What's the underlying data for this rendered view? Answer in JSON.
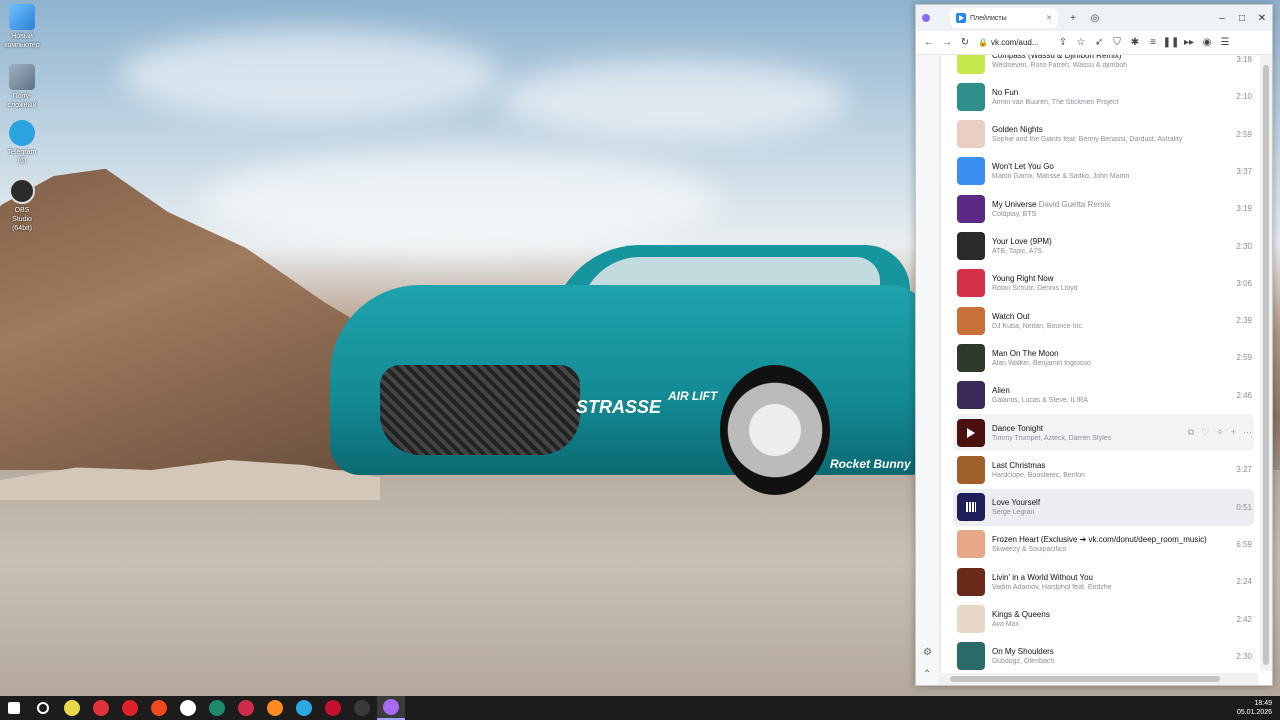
{
  "desktop": {
    "icons": [
      {
        "label": "Новый компьютер"
      },
      {
        "label": "Полу-сложный"
      },
      {
        "label": "Telegram (6)"
      },
      {
        "label": "OBS Studio (64bit)"
      }
    ]
  },
  "browser": {
    "tab_title": "Плейлисты",
    "url": "vk.com/aud...",
    "new_tab": "+",
    "window_controls": {
      "minimize": "–",
      "maximize": "□",
      "close": "✕"
    }
  },
  "tracks": [
    {
      "title": "Compass (Wassu & Djimboh Remix)",
      "subtitle": "",
      "artist": "Westseven, Ross Farren, Wassu & djimboh",
      "duration": "3:18",
      "color": "#c7e84a"
    },
    {
      "title": "No Fun",
      "subtitle": "",
      "artist": "Armin van Buuren, The Stickmen Project",
      "duration": "2:10",
      "color": "#2f8f8a"
    },
    {
      "title": "Golden Nights",
      "subtitle": "",
      "artist": "Sophie and the Giants feat. Benny Benassi, Dardust, Astrality",
      "duration": "2:59",
      "color": "#e8cfc2"
    },
    {
      "title": "Won't Let You Go",
      "subtitle": "",
      "artist": "Martin Garrix, Matisse & Sadko, John Martin",
      "duration": "3:37",
      "color": "#3a8ff0"
    },
    {
      "title": "My Universe",
      "subtitle": "David Guetta Remix",
      "artist": "Coldplay, BTS",
      "duration": "3:19",
      "color": "#5a2a86"
    },
    {
      "title": "Your Love (9PM)",
      "subtitle": "",
      "artist": "ATB, Topic, A7S",
      "duration": "2:30",
      "color": "#2a2a2a"
    },
    {
      "title": "Young Right Now",
      "subtitle": "",
      "artist": "Robin Schulz, Dennis Lloyd",
      "duration": "3:06",
      "color": "#d4304a"
    },
    {
      "title": "Watch Out",
      "subtitle": "",
      "artist": "DJ Kuba, Neitan, Bounce Inc.",
      "duration": "2:39",
      "color": "#c8703a"
    },
    {
      "title": "Man On The Moon",
      "subtitle": "",
      "artist": "Alan Walker, Benjamin Ingrosso",
      "duration": "2:59",
      "color": "#2f3a2a"
    },
    {
      "title": "Alien",
      "subtitle": "",
      "artist": "Galantis, Lucas & Steve, ILIRA",
      "duration": "2:46",
      "color": "#3a2a5a"
    },
    {
      "title": "Dance Tonight",
      "subtitle": "",
      "artist": "Timmy Trumpet, Azteck, Darren Styles",
      "duration": "",
      "color": "#4a1010"
    },
    {
      "title": "Last Christmas",
      "subtitle": "",
      "artist": "Hardclope, Boosterec, Benlon",
      "duration": "3:27",
      "color": "#a0602a"
    },
    {
      "title": "Love Yourself",
      "subtitle": "",
      "artist": "Serge Legran",
      "duration": "0:51",
      "color": "#1e1e5a"
    },
    {
      "title": "Frozen Heart (Exclusive ➔ vk.com/donut/deep_room_music)",
      "subtitle": "",
      "artist": "Skweezy & Soulpacifico",
      "duration": "6:59",
      "color": "#e8a888"
    },
    {
      "title": "Livin' in a World Without You",
      "subtitle": "",
      "artist": "Vadim Adamov, Hardphol feat. Endzhe",
      "duration": "2:24",
      "color": "#6a2a1a"
    },
    {
      "title": "Kings & Queens",
      "subtitle": "",
      "artist": "Ava Max",
      "duration": "2:42",
      "color": "#e8d8c8"
    },
    {
      "title": "On My Shoulders",
      "subtitle": "",
      "artist": "Dubdogz, Ofenbach",
      "duration": "2:30",
      "color": "#2a6a6a"
    }
  ],
  "hover_row": 10,
  "current_row": 12,
  "taskbar": {
    "time": "18:49",
    "date": "05.01.2026",
    "apps": [
      "windows-start",
      "search",
      "file-manager",
      "vivaldi",
      "opera",
      "brave",
      "yandex",
      "edge-dev",
      "opera-gx",
      "firefox",
      "edge",
      "opera-red",
      "obs",
      "browser-active"
    ]
  }
}
